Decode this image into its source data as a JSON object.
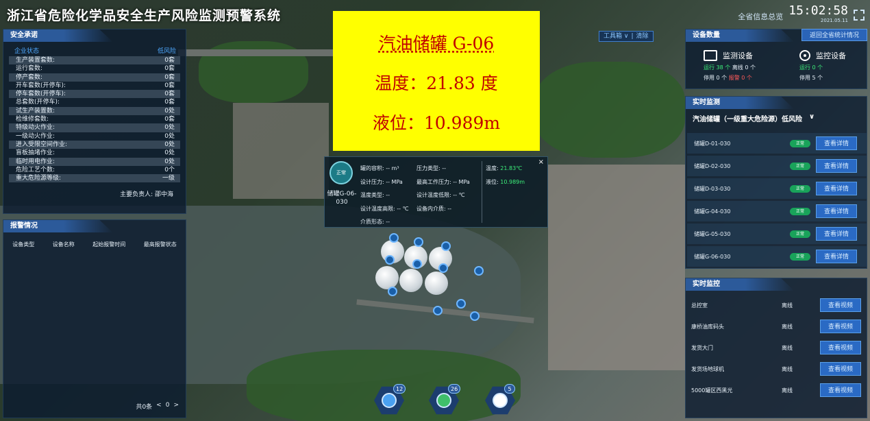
{
  "header": {
    "title": "浙江省危险化学品安全生产风险监测预警系统",
    "overview_link": "全省信息总览",
    "time": "15:02:58",
    "date": "2021.05.11",
    "fullscreen_icon": "fullscreen-icon"
  },
  "safety": {
    "title": "安全承诺",
    "status_label": "企业状态",
    "status_value": "低风险",
    "rows": [
      {
        "label": "生产装置套数:",
        "value": "0套"
      },
      {
        "label": "运行套数:",
        "value": "0套"
      },
      {
        "label": "停产套数:",
        "value": "0套"
      },
      {
        "label": "开车套数(开停车):",
        "value": "0套"
      },
      {
        "label": "停车套数(开停车):",
        "value": "0套"
      },
      {
        "label": "总套数(开停车):",
        "value": "0套"
      },
      {
        "label": "试生产装置数:",
        "value": "0处"
      },
      {
        "label": "检维修套数:",
        "value": "0套"
      },
      {
        "label": "特级动火作业:",
        "value": "0处"
      },
      {
        "label": "一级动火作业:",
        "value": "0处"
      },
      {
        "label": "进入受限空间作业:",
        "value": "0处"
      },
      {
        "label": "盲板抽堵作业:",
        "value": "0处"
      },
      {
        "label": "临时用电作业:",
        "value": "0处"
      },
      {
        "label": "危险工艺个数:",
        "value": "0个"
      },
      {
        "label": "重大危险源等级:",
        "value": "一级"
      }
    ],
    "owner": "主要负责人: 邵中海"
  },
  "alarm": {
    "title": "报警情况",
    "columns": [
      "设备类型",
      "设备名称",
      "起始报警时间",
      "最高报警状态"
    ],
    "total": "共0条",
    "page": "0",
    "prev": "<",
    "next": ">"
  },
  "note": {
    "line1": "汽油储罐 G-06",
    "line2": "温度：21.83 度",
    "line3": "液位：10.989m"
  },
  "toolbox": {
    "tools": "工具箱 ∨",
    "sep": "|",
    "clear": "清除"
  },
  "popup": {
    "badge": "正常",
    "name": "储罐G-06-030",
    "capacity": "罐的容积: -- m³",
    "pressure_type": "压力类型: --",
    "design_pressure": "设计压力: -- MPa",
    "max_work_pressure": "最高工作压力: -- MPa",
    "temp_type": "温度类型: --",
    "design_temp_low": "设计温度低限: -- ℃",
    "design_temp_high": "设计温度高限: -- ℃",
    "medium": "设备内介质: --",
    "medium_form": "介质形态: --",
    "temp_label": "温度:",
    "temp_value": "21.83℃",
    "level_label": "液位:",
    "level_value": "10.989m",
    "close": "×"
  },
  "devices": {
    "title": "设备数量",
    "back_button": "返回全省统计情况",
    "monitor_title": "监测设备",
    "monitor_running": "运行 38 个",
    "monitor_offline": "离线 0 个",
    "monitor_stopped": "停用 0 个",
    "monitor_alarm": "报警 0 个",
    "video_title": "监控设备",
    "video_running": "运行 0 个",
    "video_stopped": "停用 5 个"
  },
  "monitor": {
    "title": "实时监测",
    "subtitle": "汽油储罐（一级重大危险源）低风险",
    "chevron": "∨",
    "status": "正常",
    "detail_button": "查看详情",
    "tanks": [
      "储罐D-01-030",
      "储罐D-02-030",
      "储罐D-03-030",
      "储罐G-04-030",
      "储罐G-05-030",
      "储罐G-06-030"
    ]
  },
  "video": {
    "title": "实时监控",
    "button": "查看视频",
    "cameras": [
      {
        "name": "总控室",
        "status": "离线"
      },
      {
        "name": "康桥油库码头",
        "status": "离线"
      },
      {
        "name": "发货大门",
        "status": "离线"
      },
      {
        "name": "发货场地球机",
        "status": "离线"
      },
      {
        "name": "5000罐区西黑光",
        "status": "离线"
      }
    ]
  },
  "bottom": {
    "counts": [
      "12",
      "26",
      "5"
    ]
  }
}
